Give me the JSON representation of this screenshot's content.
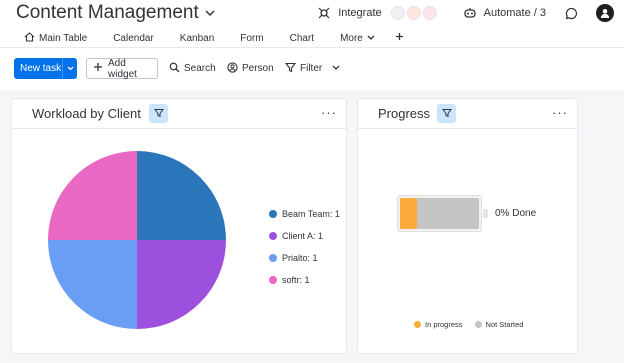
{
  "header": {
    "title": "Content Management",
    "integrate_label": "Integrate",
    "automate_label": "Automate / 3"
  },
  "tabs": [
    {
      "label": "Main Table",
      "icon": "home-icon"
    },
    {
      "label": "Calendar"
    },
    {
      "label": "Kanban"
    },
    {
      "label": "Form"
    },
    {
      "label": "Chart",
      "active": true
    },
    {
      "label": "More"
    }
  ],
  "toolbar": {
    "new_task_label": "New task",
    "add_widget_label": "Add widget",
    "search_label": "Search",
    "person_label": "Person",
    "filter_label": "Filter"
  },
  "workload_widget": {
    "title": "Workload by Client",
    "chart_data": {
      "type": "pie",
      "title": "Workload by Client",
      "slices": [
        {
          "label": "Beam Team",
          "value": 1,
          "color": "#2b76bb"
        },
        {
          "label": "Client A",
          "value": 1,
          "color": "#9d50dd"
        },
        {
          "label": "Prialto",
          "value": 1,
          "color": "#6a9ef5"
        },
        {
          "label": "softr",
          "value": 1,
          "color": "#e968c3"
        }
      ],
      "legend_entries": [
        "Beam Team: 1",
        "Client A: 1",
        "Prialto: 1",
        "softr: 1"
      ],
      "legend_position": "right"
    }
  },
  "progress_widget": {
    "title": "Progress",
    "done_text": "0% Done",
    "in_progress_fraction": 0.22,
    "legend": [
      {
        "label": "In progress",
        "color": "#fdab3d"
      },
      {
        "label": "Not Started",
        "color": "#c4c4c4"
      }
    ]
  },
  "colors": {
    "accent": "#0073ea",
    "filter_chip": "#cce5ff"
  }
}
